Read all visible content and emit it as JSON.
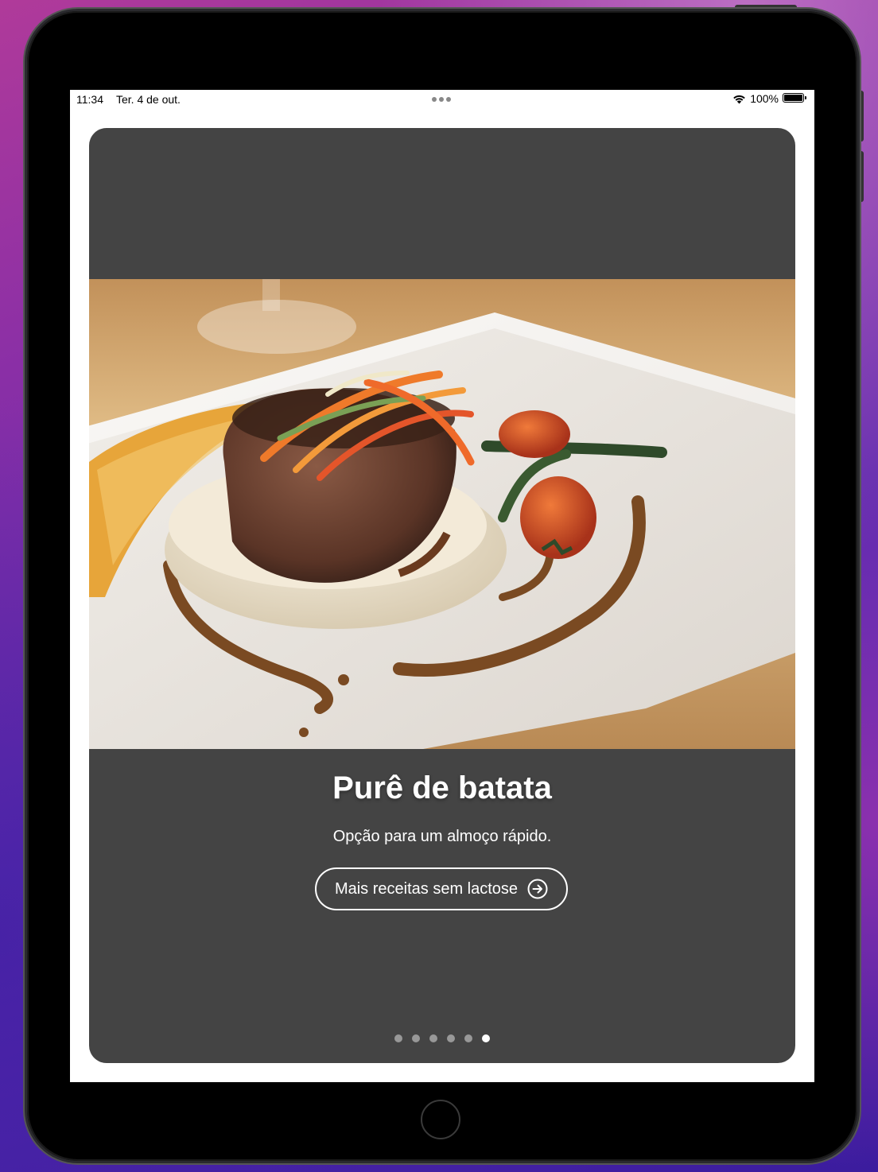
{
  "status_bar": {
    "time": "11:34",
    "date": "Ter. 4 de out.",
    "battery": "100%",
    "icons": [
      "wifi-icon",
      "battery-icon",
      "multitasking-dots-icon"
    ]
  },
  "card": {
    "image_alt": "Filé grelhado com purê de batata, legumes e tomate assado",
    "title": "Purê de batata",
    "subtitle": "Opção para um almoço rápido.",
    "button_label": "Mais receitas sem lactose",
    "button_icon": "arrow-right-circle-icon",
    "page_count": 6,
    "current_page": 6
  },
  "colors": {
    "card_background": "#444444",
    "text": "#ffffff"
  }
}
